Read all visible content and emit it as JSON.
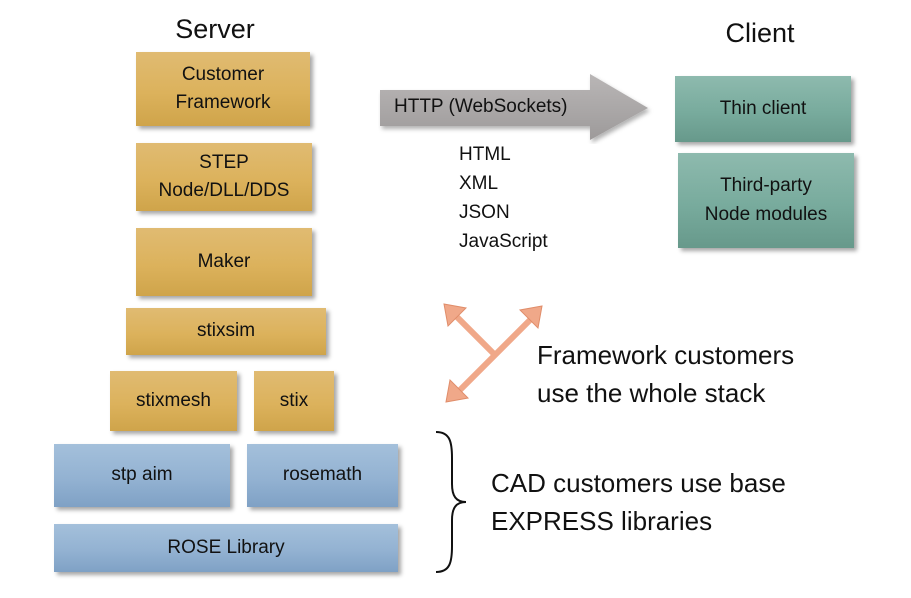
{
  "server": {
    "title": "Server",
    "layers": [
      {
        "label_lines": [
          "Customer",
          "Framework"
        ]
      },
      {
        "label_lines": [
          "STEP",
          "Node/DLL/DDS"
        ]
      },
      {
        "label": "Maker"
      },
      {
        "label": "stixsim"
      },
      {
        "label": "stixmesh"
      },
      {
        "label": "stix"
      },
      {
        "label": "stp aim"
      },
      {
        "label": "rosemath"
      },
      {
        "label": "ROSE Library"
      }
    ]
  },
  "client": {
    "title": "Client",
    "boxes": [
      {
        "label": "Thin client"
      },
      {
        "label_lines": [
          "Third-party",
          "Node modules"
        ]
      }
    ]
  },
  "connection": {
    "arrow_label": "HTTP (WebSockets)",
    "formats": [
      "HTML",
      "XML",
      "JSON",
      "JavaScript"
    ]
  },
  "notes": {
    "framework": [
      "Framework customers",
      "use the whole stack"
    ],
    "cad": [
      "CAD customers use base",
      "EXPRESS libraries"
    ]
  },
  "colors": {
    "server_upper": "#dcb25c",
    "server_base": "#93b2d2",
    "client": "#78ab9d",
    "http_arrow": "#a8a5a5",
    "framework_arrows": "#f0a889"
  }
}
